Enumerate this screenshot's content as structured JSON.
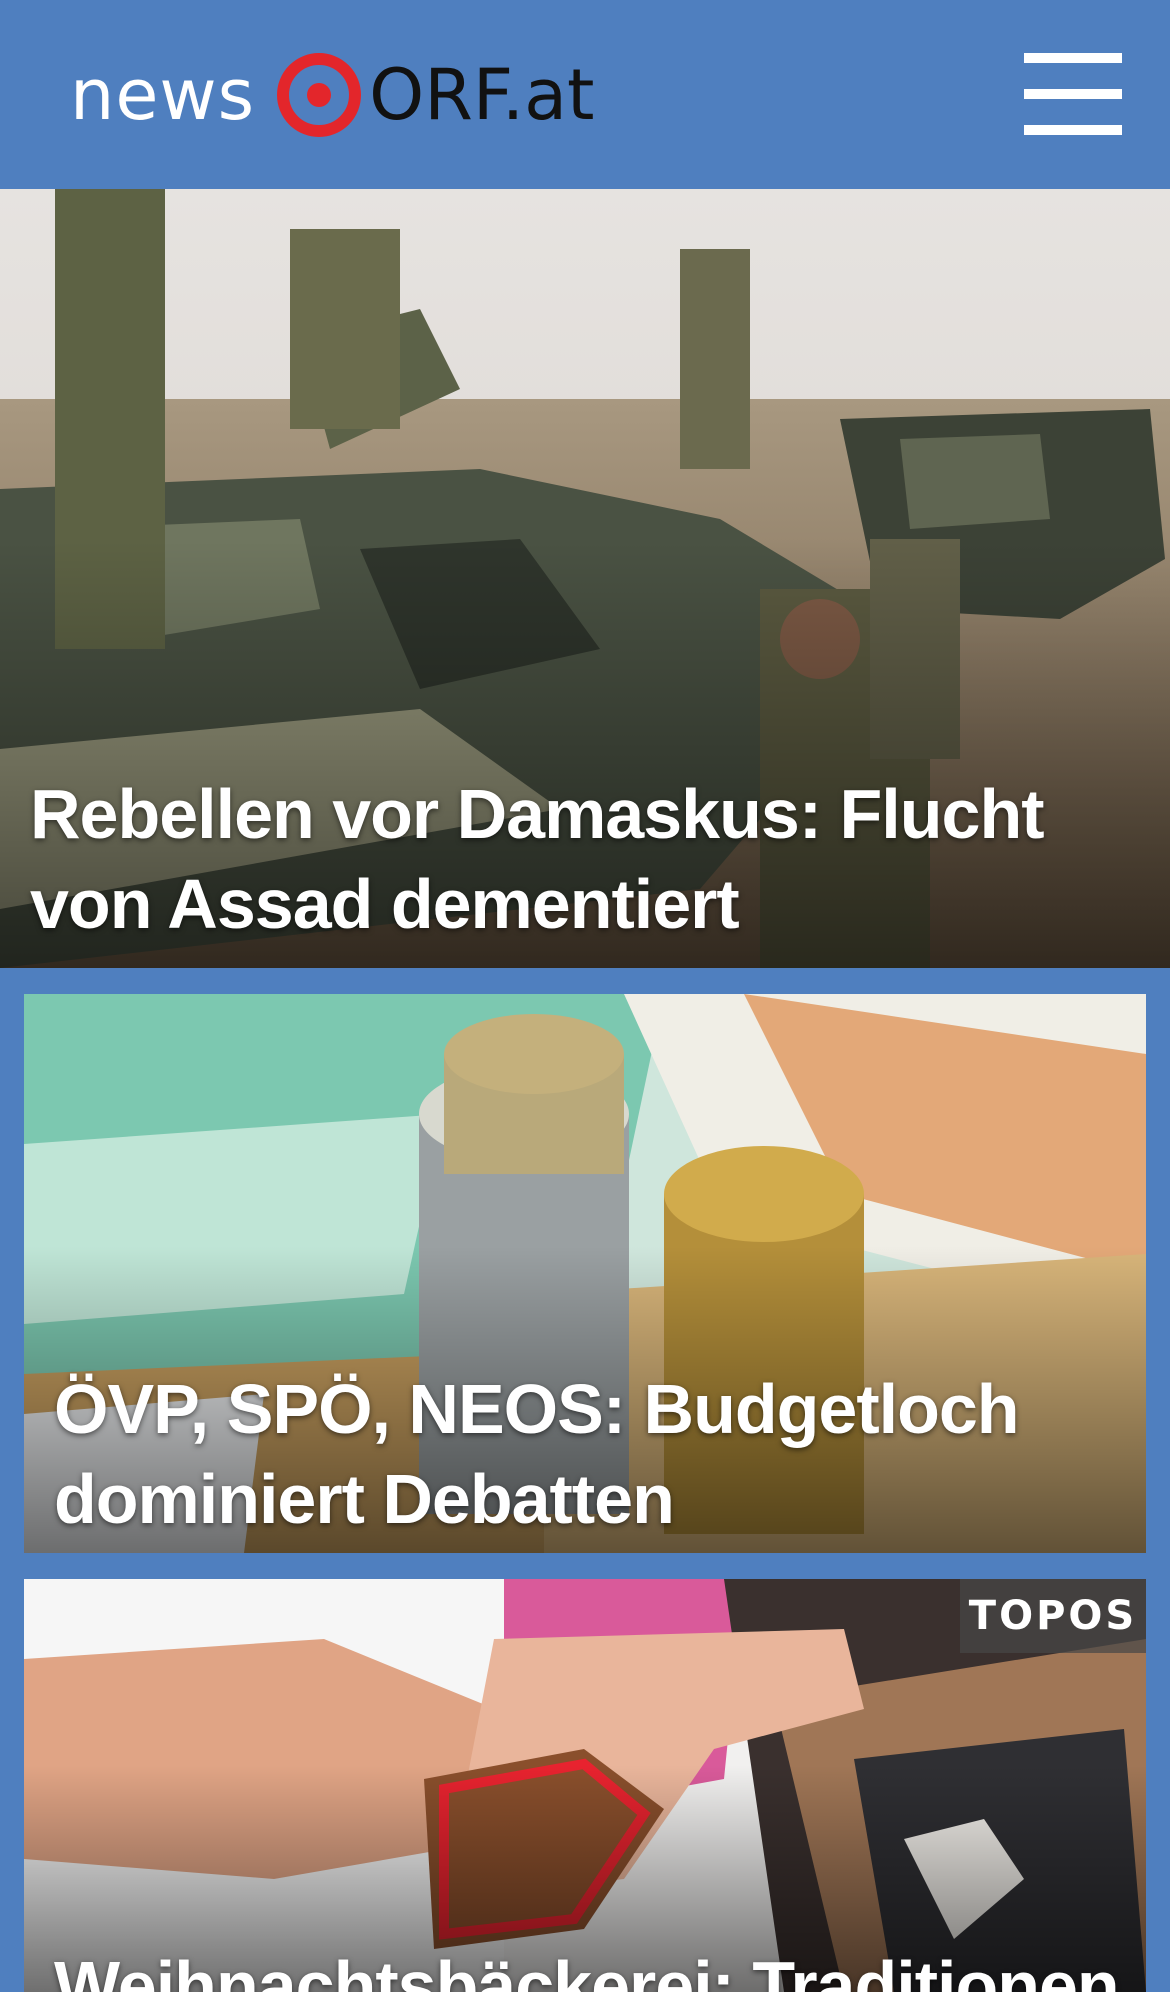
{
  "header": {
    "logo_news": "news",
    "logo_orf": "ORF.at",
    "menu_icon": "hamburger-menu-icon"
  },
  "colors": {
    "brand_blue": "#4f7fbf",
    "orf_red": "#e3262b"
  },
  "articles": [
    {
      "headline": "Rebellen vor Damaskus: Flucht von Assad dementiert"
    },
    {
      "headline": "ÖVP, SPÖ, NEOS: Budgetloch dominiert Debatten"
    },
    {
      "badge": "TOPOS",
      "headline": "Weihnachtsbäckerei: Traditionen"
    }
  ]
}
